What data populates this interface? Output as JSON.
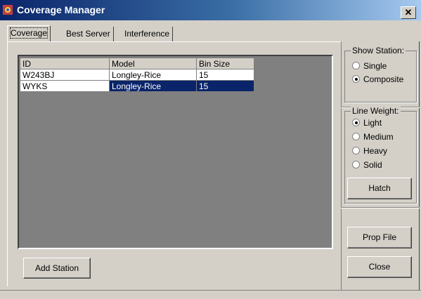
{
  "window": {
    "title": "Coverage Manager",
    "close_glyph": "✕"
  },
  "tabs": [
    {
      "label": "Coverage",
      "active": true
    },
    {
      "label": "Best Server",
      "active": false
    },
    {
      "label": "Interference",
      "active": false
    }
  ],
  "grid": {
    "columns": [
      "ID",
      "Model",
      "Bin Size"
    ],
    "rows": [
      {
        "id": "W243BJ",
        "model": "Longley-Rice",
        "bin_size": "15",
        "selected": false
      },
      {
        "id": "WYKS",
        "model": "Longley-Rice",
        "bin_size": "15",
        "selected": true
      }
    ],
    "selection_color": "#0a246a"
  },
  "add_station_label": "Add Station",
  "show_station": {
    "label": "Show Station:",
    "options": [
      "Single",
      "Composite"
    ],
    "selected": "Composite"
  },
  "line_weight": {
    "label": "Line Weight:",
    "options": [
      "Light",
      "Medium",
      "Heavy",
      "Solid"
    ],
    "selected": "Light"
  },
  "hatch_label": "Hatch",
  "prop_file_label": "Prop File",
  "close_label": "Close"
}
